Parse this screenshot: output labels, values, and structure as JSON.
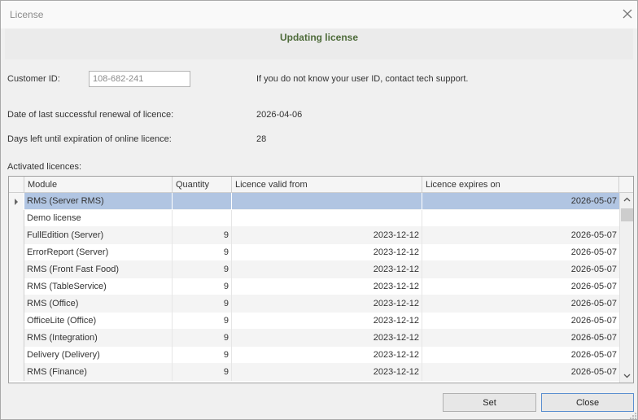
{
  "window": {
    "title": "License"
  },
  "banner": {
    "text": "Updating license"
  },
  "customer": {
    "label": "Customer ID:",
    "value": "108-682-241",
    "hint": "If you do not know your user ID, contact tech support."
  },
  "renewal": {
    "label": "Date of last successful renewal of licence:",
    "value": "2026-04-06"
  },
  "days_left": {
    "label": "Days left until expiration of online licence:",
    "value": "28"
  },
  "grid": {
    "title": "Activated licences:",
    "columns": [
      "Module",
      "Quantity",
      "Licence valid from",
      "Licence expires on"
    ],
    "rows": [
      {
        "module": "RMS (Server RMS)",
        "quantity": "",
        "from": "",
        "expires": "2026-05-07",
        "selected": true
      },
      {
        "module": "Demo license",
        "quantity": "",
        "from": "",
        "expires": ""
      },
      {
        "module": "FullEdition (Server)",
        "quantity": "9",
        "from": "2023-12-12",
        "expires": "2026-05-07"
      },
      {
        "module": "ErrorReport (Server)",
        "quantity": "9",
        "from": "2023-12-12",
        "expires": "2026-05-07"
      },
      {
        "module": "RMS (Front Fast Food)",
        "quantity": "9",
        "from": "2023-12-12",
        "expires": "2026-05-07"
      },
      {
        "module": "RMS (TableService)",
        "quantity": "9",
        "from": "2023-12-12",
        "expires": "2026-05-07"
      },
      {
        "module": "RMS (Office)",
        "quantity": "9",
        "from": "2023-12-12",
        "expires": "2026-05-07"
      },
      {
        "module": "OfficeLite (Office)",
        "quantity": "9",
        "from": "2023-12-12",
        "expires": "2026-05-07"
      },
      {
        "module": "RMS (Integration)",
        "quantity": "9",
        "from": "2023-12-12",
        "expires": "2026-05-07"
      },
      {
        "module": "Delivery (Delivery)",
        "quantity": "9",
        "from": "2023-12-12",
        "expires": "2026-05-07"
      },
      {
        "module": "RMS (Finance)",
        "quantity": "9",
        "from": "2023-12-12",
        "expires": "2026-05-07"
      }
    ]
  },
  "buttons": {
    "set": "Set",
    "close": "Close"
  },
  "icons": {
    "close": "close-icon",
    "scroll_up": "chevron-up-icon",
    "scroll_down": "chevron-down-icon",
    "row_indicator": "row-indicator-icon",
    "resize": "resize-grip-icon"
  },
  "colors": {
    "banner_text": "#4e6b3a",
    "selected_row": "#b1c5e2",
    "primary_border": "#5b8fd0"
  }
}
